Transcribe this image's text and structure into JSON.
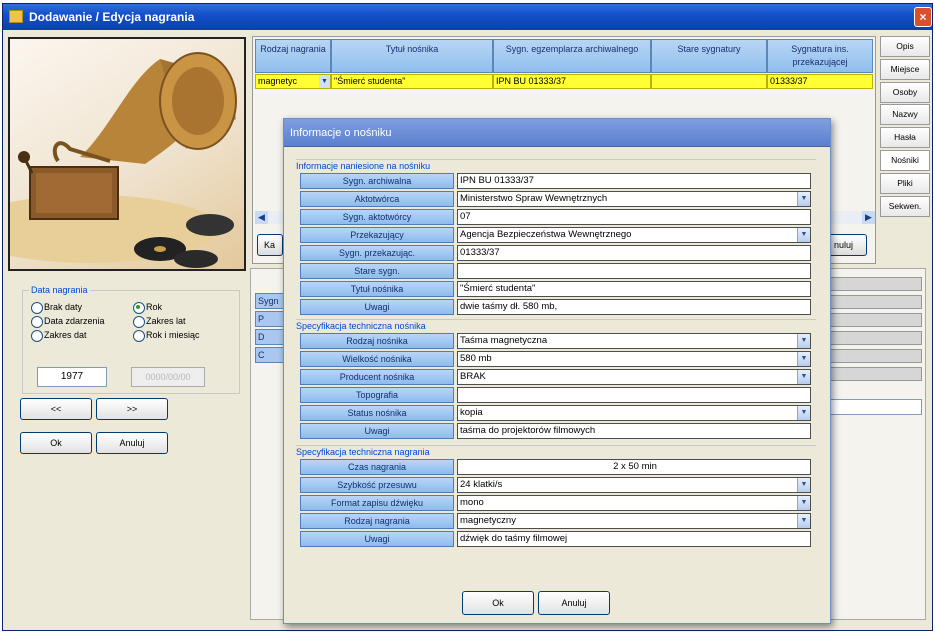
{
  "window": {
    "title": "Dodawanie / Edycja nagrania",
    "close_glyph": "×"
  },
  "grid": {
    "columns": [
      "Rodzaj nagrania",
      "Tytuł nośnika",
      "Sygn. egzemplarza archiwalnego",
      "Stare sygnatury",
      "Sygnatura ins. przekazującej"
    ],
    "row": {
      "rodzaj": "magnetyc",
      "tytul": "\"Śmierć studenta\"",
      "sygn": "IPN BU 01333/37",
      "stare": "",
      "sygnatura": "01333/37"
    }
  },
  "grid_buttons": {
    "left": "Ka",
    "right": "nuluj"
  },
  "tabs": [
    "Opis",
    "Miejsce",
    "Osoby",
    "Nazwy",
    "Hasła",
    "Nośniki",
    "Pliki",
    "Sekwen."
  ],
  "lower_stubs": [
    "Sygn",
    "P",
    "D",
    "C"
  ],
  "date_panel": {
    "title": "Data nagrania",
    "options": [
      "Brak daty",
      "Data zdarzenia",
      "Zakres dat",
      "Rok",
      "Zakres lat",
      "Rok i miesiąc"
    ],
    "selected": "Rok",
    "year": "1977",
    "year_placeholder": "0000/00/00"
  },
  "nav_buttons": {
    "prev": "<<",
    "next": ">>",
    "ok": "Ok",
    "cancel": "Anuluj"
  },
  "dialog": {
    "title": "Informacje o nośniku",
    "sections": [
      {
        "title": "Informacje naniesione na nośniku",
        "fields": [
          {
            "label": "Sygn. archiwalna",
            "value": "IPN BU 01333/37",
            "combo": false
          },
          {
            "label": "Aktotwórca",
            "value": "Ministerstwo Spraw Wewnętrznych",
            "combo": true
          },
          {
            "label": "Sygn. aktotwórcy",
            "value": "07",
            "combo": false
          },
          {
            "label": "Przekazujący",
            "value": "Agencja Bezpieczeństwa Wewnętrznego",
            "combo": true
          },
          {
            "label": "Sygn. przekazując.",
            "value": "01333/37",
            "combo": false
          },
          {
            "label": "Stare sygn.",
            "value": "",
            "combo": false
          },
          {
            "label": "Tytuł nośnika",
            "value": "\"Śmierć studenta\"",
            "combo": false
          },
          {
            "label": "Uwagi",
            "value": "dwie taśmy dł. 580 mb,",
            "combo": false
          }
        ]
      },
      {
        "title": "Specyfikacja techniczna nośnika",
        "fields": [
          {
            "label": "Rodzaj nośnika",
            "value": "Taśma magnetyczna",
            "combo": true
          },
          {
            "label": "Wielkość nośnika",
            "value": "580 mb",
            "combo": true
          },
          {
            "label": "Producent nośnika",
            "value": "BRAK",
            "combo": true
          },
          {
            "label": "Topografia",
            "value": "",
            "combo": false
          },
          {
            "label": "Status nośnika",
            "value": "kopia",
            "combo": true
          },
          {
            "label": "Uwagi",
            "value": "taśma do projektorów filmowych",
            "combo": false
          }
        ]
      },
      {
        "title": "Specyfikacja techniczna nagrania",
        "fields": [
          {
            "label": "Czas nagrania",
            "value": "2 x 50 min",
            "combo": false,
            "center": true
          },
          {
            "label": "Szybkość przesuwu",
            "value": "24 klatki/s",
            "combo": true
          },
          {
            "label": "Format zapisu dźwięku",
            "value": "mono",
            "combo": true
          },
          {
            "label": "Rodzaj nagrania",
            "value": "magnetyczny",
            "combo": true
          },
          {
            "label": "Uwagi",
            "value": "dźwięk do taśmy filmowej",
            "combo": false
          }
        ]
      }
    ],
    "ok": "Ok",
    "cancel": "Anuluj"
  }
}
